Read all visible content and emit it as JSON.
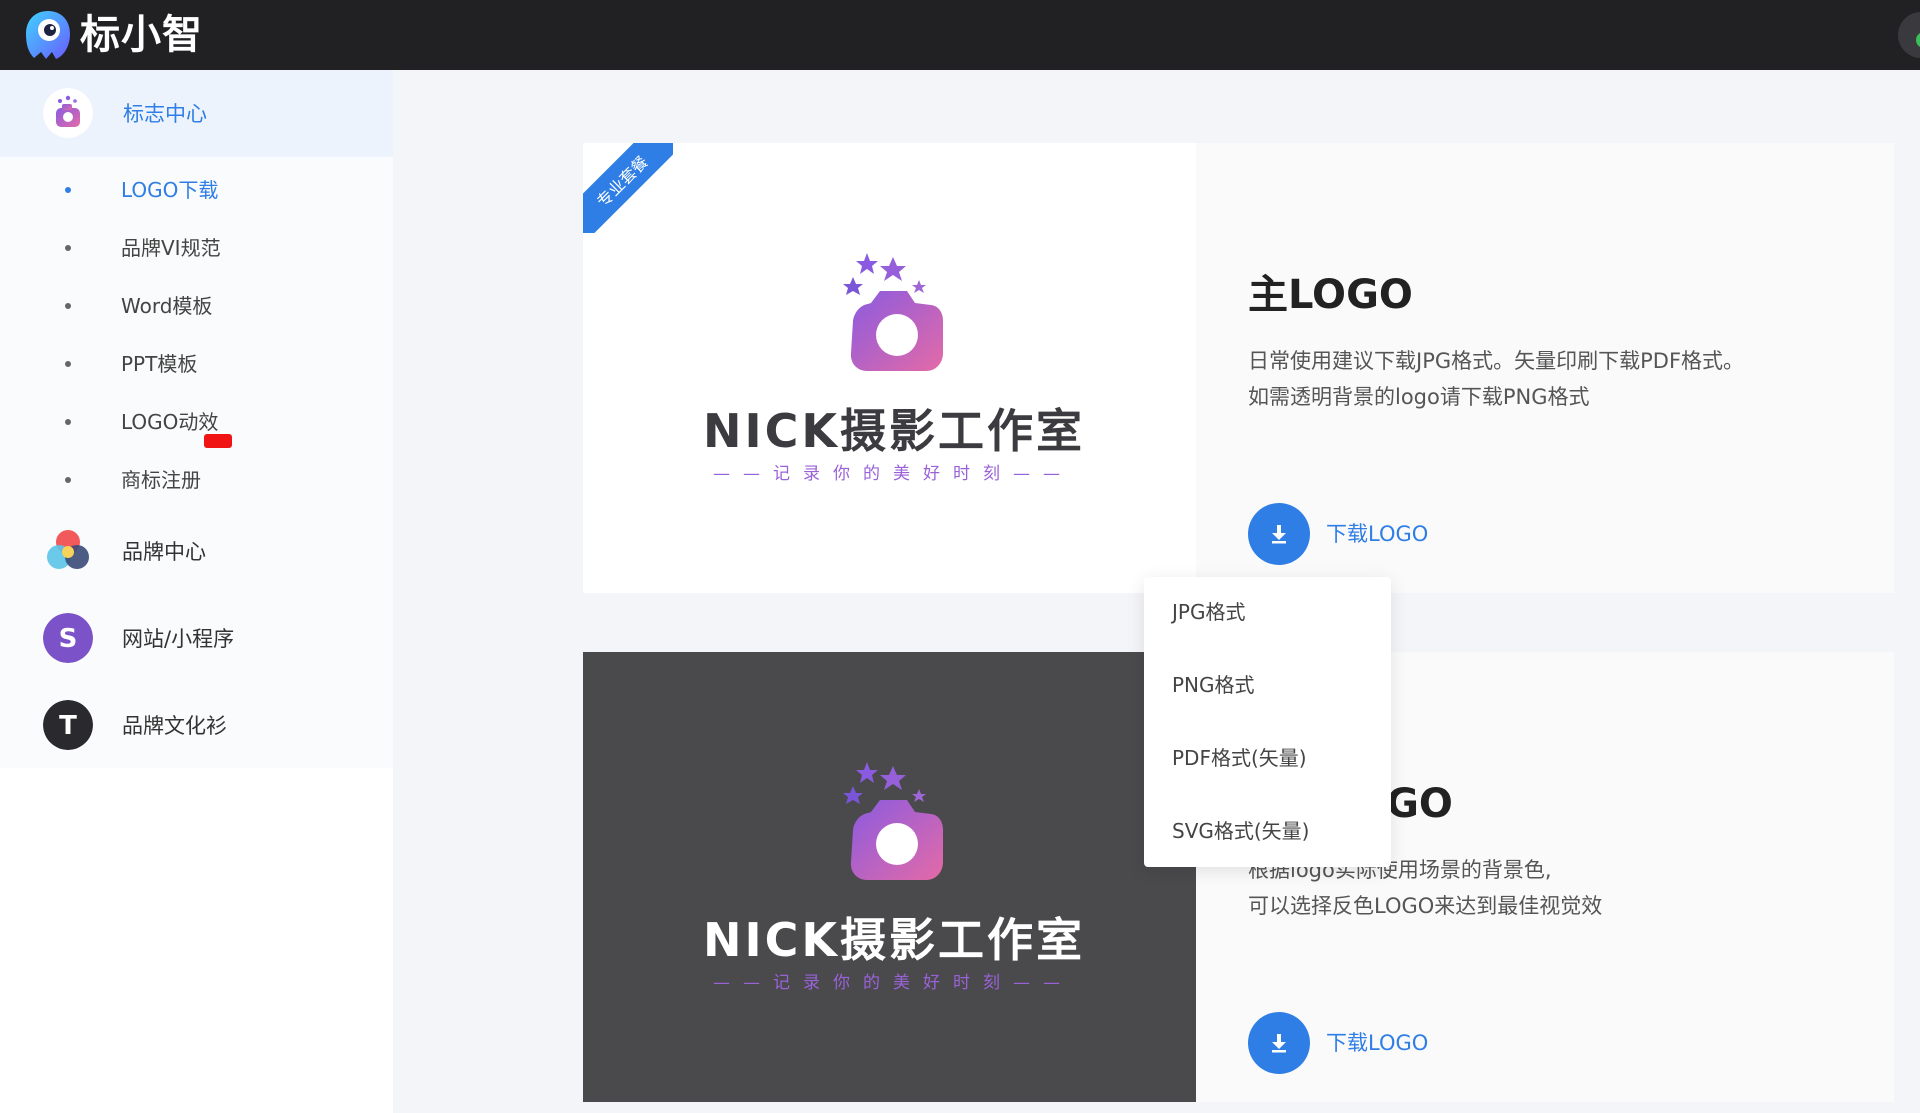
{
  "app": {
    "name": "标小智"
  },
  "sidebar": {
    "logo_center_label": "标志中心",
    "sub_items": [
      {
        "label": "LOGO下载",
        "active": true
      },
      {
        "label": "品牌VI规范"
      },
      {
        "label": "Word模板"
      },
      {
        "label": "PPT模板"
      },
      {
        "label": "LOGO动效"
      },
      {
        "label": "商标注册"
      }
    ],
    "sections": [
      {
        "label": "品牌中心",
        "icon": "color-circles-icon"
      },
      {
        "label": "网站/小程序",
        "icon": "s-letter-icon"
      },
      {
        "label": "品牌文化衫",
        "icon": "t-letter-icon"
      }
    ]
  },
  "cards": [
    {
      "badge": "专业套餐",
      "logo_title": "NICK摄影工作室",
      "logo_slogan": "——记录你的美好时刻——",
      "title": "主LOGO",
      "desc_line1": "日常使用建议下载JPG格式。矢量印刷下载PDF格式。",
      "desc_line2": "如需透明背景的logo请下载PNG格式",
      "download_label": "下载LOGO"
    },
    {
      "logo_title": "NICK摄影工作室",
      "logo_slogan": "——记录你的美好时刻——",
      "title_fragment": "GO",
      "desc_line1": "根据logo实际使用场景的背景色,",
      "desc_line2": "可以选择反色LOGO来达到最佳视觉效",
      "download_label": "下载LOGO"
    }
  ],
  "dropdown": {
    "options": [
      "JPG格式",
      "PNG格式",
      "PDF格式(矢量)",
      "SVG格式(矢量)"
    ]
  },
  "colors": {
    "accent": "#2f7ee6",
    "topbar": "#212124",
    "dark_preview_bg": "#4a4a4c",
    "logo_gradient_start": "#8a5be0",
    "logo_gradient_end": "#e46aa7"
  }
}
